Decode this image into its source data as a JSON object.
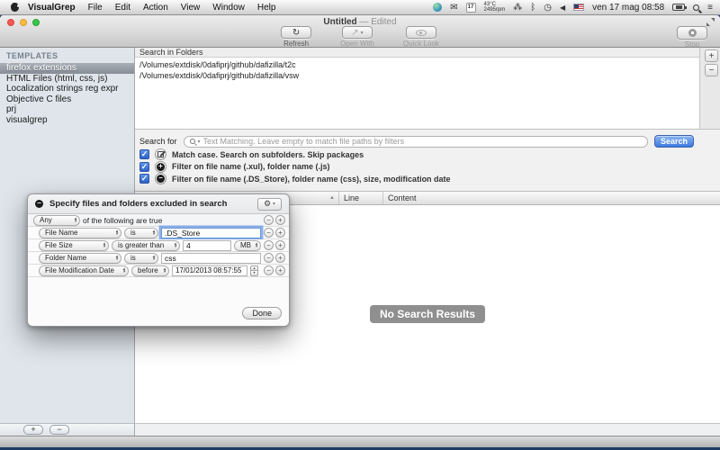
{
  "menu_bar": {
    "app_menu": "VisualGrep",
    "menus": [
      "File",
      "Edit",
      "Action",
      "View",
      "Window",
      "Help"
    ],
    "status": {
      "calendar_day": "17",
      "temperature": "43°C",
      "fan_speed": "2495rpm",
      "clock": "ven 17 mag 08:58"
    }
  },
  "window": {
    "title": "Untitled",
    "edited_suffix": "— Edited",
    "toolbar": {
      "refresh": "Refresh",
      "open_with": "Open With",
      "quick_look": "Quick Look",
      "stop": "Stop"
    }
  },
  "sidebar": {
    "header": "TEMPLATES",
    "items": [
      "firefox extensions",
      "HTML Files (html, css, js)",
      "Localization strings reg expr",
      "Objective C files",
      "prj",
      "visualgrep"
    ],
    "selected_item": "firefox extensions"
  },
  "search_panel": {
    "folders_header": "Search in Folders",
    "folders": [
      "/Volumes/extdisk/0dafiprj/github/dafizilla/t2c",
      "/Volumes/extdisk/0dafiprj/github/dafizilla/vsw"
    ],
    "search_label": "Search for",
    "search_placeholder": "Text Matching. Leave empty to match file paths by filters",
    "search_button": "Search",
    "options": [
      "Match case. Search on subfolders. Skip packages",
      "Filter on file name (.xul), folder name (.js)",
      "Filter on file name (.DS_Store), folder name (css), size, modification date"
    ]
  },
  "results": {
    "columns": {
      "line": "Line",
      "content": "Content"
    },
    "empty_message": "No Search Results"
  },
  "popover": {
    "title": "Specify files and folders excluded in search",
    "compound_popup": "Any",
    "compound_suffix": "of the following are true",
    "rules": [
      {
        "field": "File Name",
        "operator": "is",
        "value": ".DS_Store"
      },
      {
        "field": "File Size",
        "operator": "is greater than",
        "value": "4",
        "unit": "MB"
      },
      {
        "field": "Folder Name",
        "operator": "is",
        "value": "css"
      },
      {
        "field": "File Modification Date",
        "operator": "before",
        "value": "17/01/2013 08:57:55"
      }
    ],
    "done_button": "Done"
  },
  "icons": {
    "refresh": "↻",
    "open_with": "↗",
    "gear": "⚙",
    "caret_down": "▾",
    "caret_up": "▴",
    "plus": "+",
    "minus": "−",
    "check": "✓",
    "sort_asc": "▲",
    "mail": "✉",
    "paw": "⁂",
    "bluetooth": "ᛒ",
    "clock_glyph": "◷",
    "arrow": "◀",
    "list": "≡"
  },
  "colors": {
    "accent_blue": "#3d79dd",
    "checkbox_blue": "#2e62c8",
    "sidebar_bg": "#dfe5eb",
    "selection_gray": "#868e98",
    "desktop": "#1e3b66",
    "badge_gray": "#8f8f8f"
  }
}
